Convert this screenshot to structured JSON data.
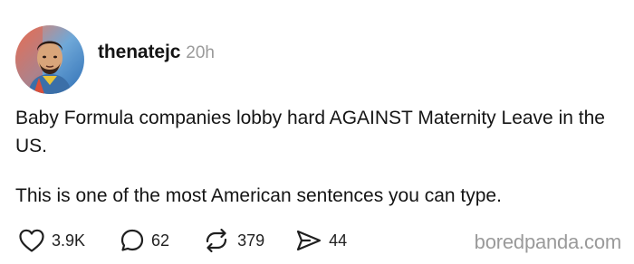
{
  "post": {
    "author": {
      "username": "thenatejc",
      "time": "20h",
      "avatar_icon": "avatar-portrait"
    },
    "paragraphs": [
      "Baby Formula companies lobby hard AGAINST Maternity Leave in the US.",
      "This is one of the most American sentences you can type."
    ],
    "actions": {
      "likes": {
        "icon": "heart-icon",
        "count": "3.9K"
      },
      "replies": {
        "icon": "comment-icon",
        "count": "62"
      },
      "reposts": {
        "icon": "repost-icon",
        "count": "379"
      },
      "shares": {
        "icon": "share-icon",
        "count": "44"
      }
    }
  },
  "watermark": "boredpanda.com",
  "colors": {
    "text": "#151515",
    "muted": "#9a9a9a",
    "background": "#ffffff"
  }
}
